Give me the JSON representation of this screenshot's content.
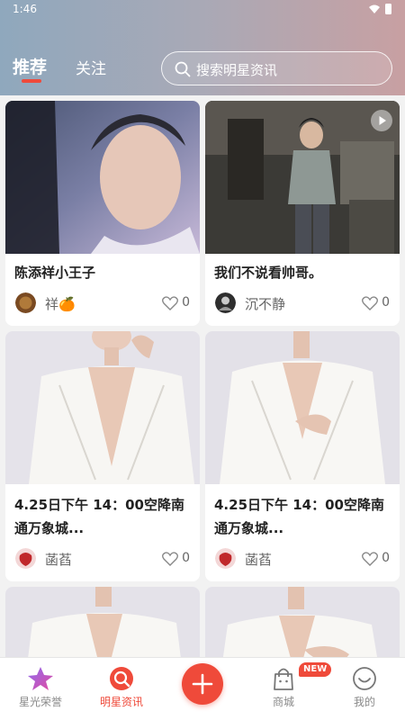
{
  "status_bar": {
    "time": "1:46"
  },
  "header": {
    "tabs": [
      {
        "label": "推荐",
        "active": true
      },
      {
        "label": "关注",
        "active": false
      }
    ],
    "search": {
      "placeholder": "搜索明星资讯"
    }
  },
  "feed": {
    "cards": [
      {
        "title": "陈添祥小王子",
        "author": "祥🍊",
        "likes": "0",
        "image": "portrait-closeup"
      },
      {
        "title": "我们不说看帅哥。",
        "author": "沉不静",
        "likes": "0",
        "image": "cafe-photo",
        "video": true
      },
      {
        "title": "4.25日下午 14：00空降南通万象城...",
        "author": "菡萏",
        "likes": "0",
        "image": "white-suit"
      },
      {
        "title": "4.25日下午 14：00空降南通万象城...",
        "author": "菡萏",
        "likes": "0",
        "image": "white-suit"
      },
      {
        "title": "",
        "author": "",
        "likes": "",
        "image": "white-suit"
      },
      {
        "title": "",
        "author": "",
        "likes": "",
        "image": "white-suit"
      }
    ]
  },
  "bottom_nav": {
    "items": [
      {
        "label": "星光荣誉",
        "icon": "star-icon",
        "active": false
      },
      {
        "label": "明星资讯",
        "icon": "news-icon",
        "active": true
      },
      {
        "label": "",
        "icon": "plus-icon",
        "active": false
      },
      {
        "label": "商城",
        "icon": "shop-bag-icon",
        "active": false,
        "badge": "NEW"
      },
      {
        "label": "我的",
        "icon": "profile-icon",
        "active": false
      }
    ]
  },
  "colors": {
    "accent": "#ef4a3a",
    "header_start": "#8fa8bd",
    "header_end": "#c8a0a2"
  }
}
